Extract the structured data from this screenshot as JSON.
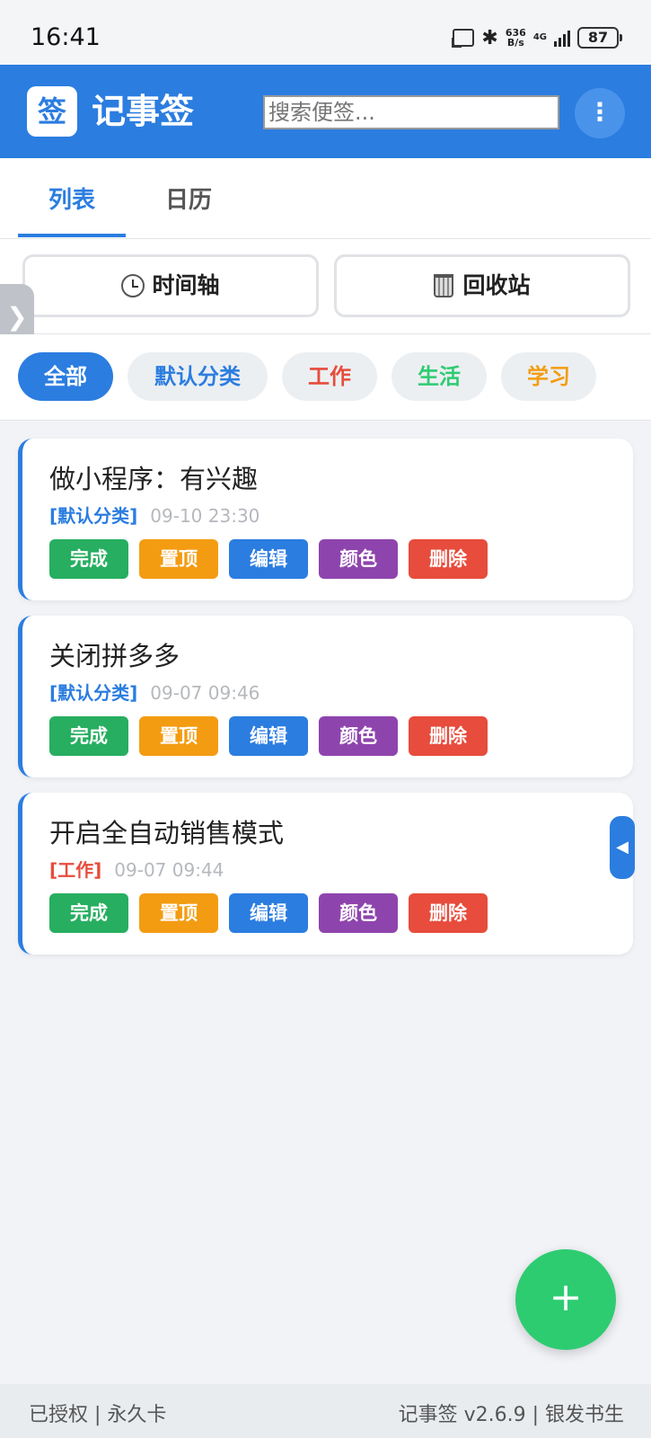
{
  "status_bar": {
    "time": "16:41",
    "net_speed_value": "636",
    "net_speed_unit": "B/s",
    "network_type": "4G",
    "battery": "87"
  },
  "app_bar": {
    "logo_char": "签",
    "title": "记事签",
    "search_placeholder": "搜索便签...",
    "more_icon": "⋮"
  },
  "tabs": [
    {
      "label": "列表",
      "active": true
    },
    {
      "label": "日历",
      "active": false
    }
  ],
  "actions": {
    "timeline_label": "时间轴",
    "recycle_label": "回收站"
  },
  "categories": [
    {
      "label": "全部",
      "color": "#ffffff",
      "bg": "#2b7de0",
      "selected": true
    },
    {
      "label": "默认分类",
      "color": "#2b7de0",
      "bg": "#eceff2",
      "selected": false
    },
    {
      "label": "工作",
      "color": "#e74c3c",
      "bg": "#eceff2",
      "selected": false
    },
    {
      "label": "生活",
      "color": "#2ecc71",
      "bg": "#eceff2",
      "selected": false
    },
    {
      "label": "学习",
      "color": "#f39c12",
      "bg": "#eceff2",
      "selected": false
    }
  ],
  "notes": [
    {
      "title": "做小程序：有兴趣",
      "category": "[默认分类]",
      "category_color": "#2b7de0",
      "date": "09-10 23:30"
    },
    {
      "title": "关闭拼多多",
      "category": "[默认分类]",
      "category_color": "#2b7de0",
      "date": "09-07 09:46"
    },
    {
      "title": "开启全自动销售模式",
      "category": "[工作]",
      "category_color": "#e74c3c",
      "date": "09-07 09:44"
    }
  ],
  "note_buttons": [
    {
      "label": "完成",
      "color": "#27ae60"
    },
    {
      "label": "置顶",
      "color": "#f39c12"
    },
    {
      "label": "编辑",
      "color": "#2b7de0"
    },
    {
      "label": "颜色",
      "color": "#8e44ad"
    },
    {
      "label": "删除",
      "color": "#e74c3c"
    }
  ],
  "side_handle_icon": "❯",
  "right_handle_icon": "◀",
  "fab_icon": "+",
  "footer": {
    "left": "已授权 | 永久卡",
    "right": "记事签 v2.6.9 | 银发书生"
  }
}
